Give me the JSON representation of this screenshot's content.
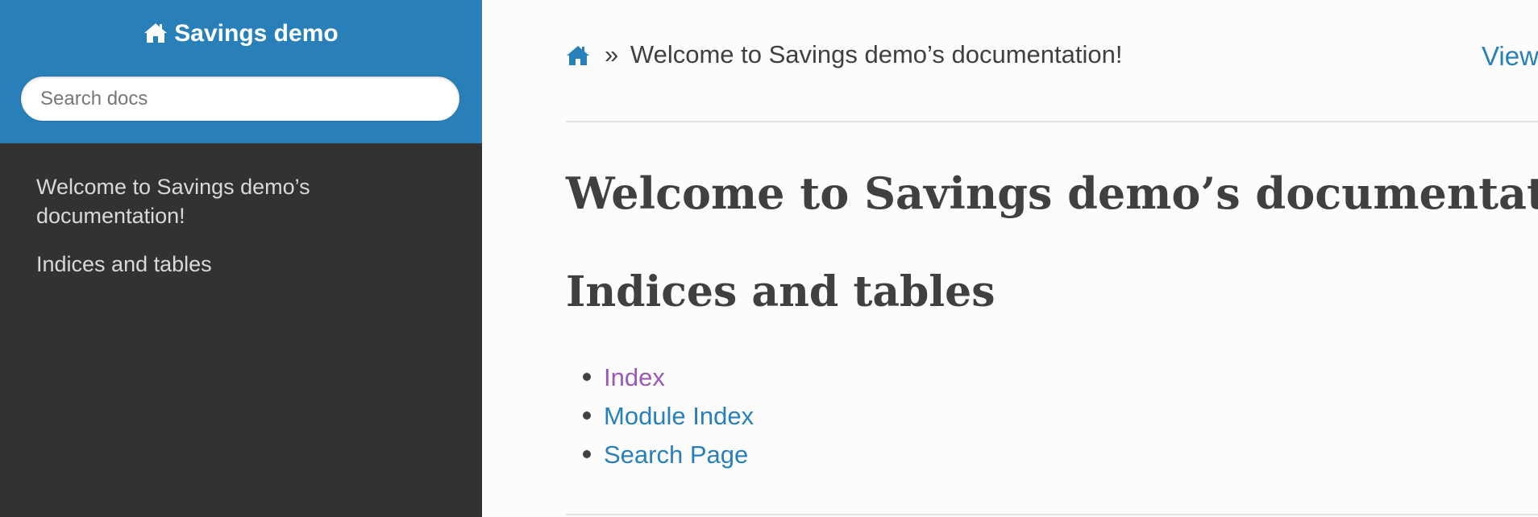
{
  "colors": {
    "sidebar_header": "#2980b9",
    "sidebar_body": "#343131",
    "link": "#2980b9",
    "visited_link": "#9b59b6",
    "text": "#404040"
  },
  "sidebar": {
    "project_title": "Savings demo",
    "project_icon": "home-icon",
    "search_placeholder": "Search docs",
    "search_value": "",
    "nav_items": [
      {
        "label": "Welcome to Savings demo’s documentation!"
      },
      {
        "label": "Indices and tables"
      }
    ]
  },
  "header": {
    "home_icon": "home-icon",
    "separator": "»",
    "current_page": "Welcome to Savings demo’s documentation!",
    "view_link": "View"
  },
  "content": {
    "title": "Welcome to Savings demo’s documentation!",
    "section_title": "Indices and tables",
    "links": [
      {
        "label": "Index",
        "visited": true
      },
      {
        "label": "Module Index",
        "visited": false
      },
      {
        "label": "Search Page",
        "visited": false
      }
    ]
  }
}
